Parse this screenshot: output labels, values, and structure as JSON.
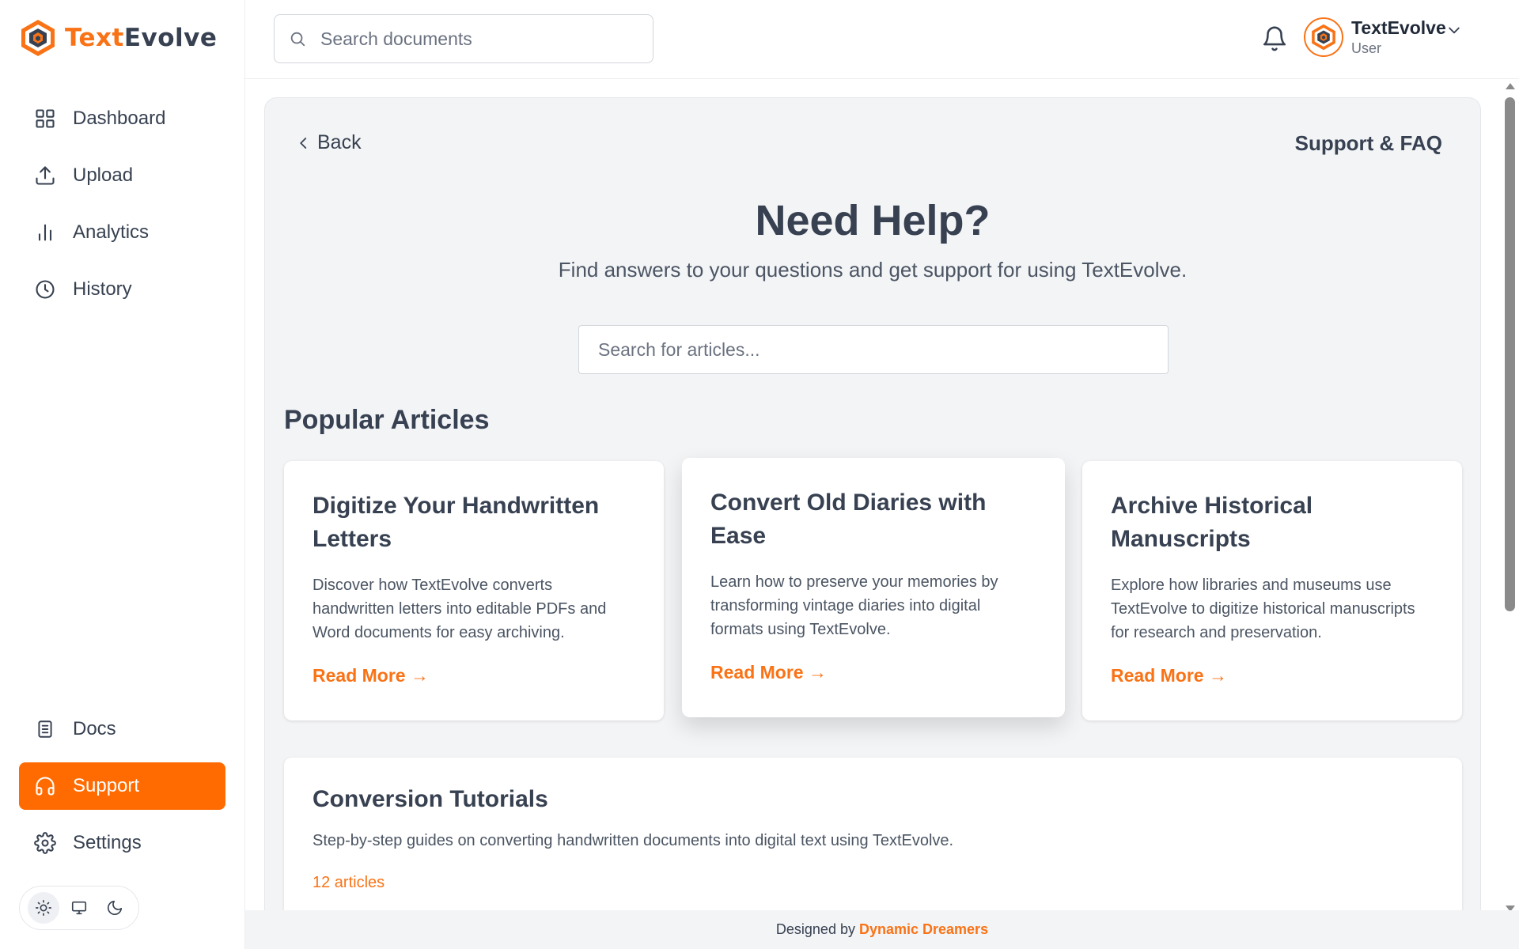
{
  "app": {
    "logo_part1": "Text",
    "logo_part2": "Evolve",
    "accent": "#ff6b00"
  },
  "sidebar": {
    "top_items": [
      {
        "label": "Dashboard",
        "icon": "grid-icon"
      },
      {
        "label": "Upload",
        "icon": "upload-icon"
      },
      {
        "label": "Analytics",
        "icon": "bar-chart-icon"
      },
      {
        "label": "History",
        "icon": "clock-icon"
      }
    ],
    "bottom_items": [
      {
        "label": "Docs",
        "icon": "document-icon"
      },
      {
        "label": "Support",
        "icon": "headphones-icon",
        "active": true
      },
      {
        "label": "Settings",
        "icon": "gear-icon"
      }
    ],
    "theme_options": [
      "light",
      "system",
      "dark"
    ],
    "theme_selected": "light"
  },
  "header": {
    "search_placeholder": "Search documents",
    "user_name": "TextEvolve",
    "user_role": "User"
  },
  "page": {
    "back_label": "Back",
    "section_label": "Support & FAQ",
    "title": "Need Help?",
    "subtitle": "Find answers to your questions and get support for using TextEvolve.",
    "article_search_placeholder": "Search for articles...",
    "popular_title": "Popular Articles",
    "articles": [
      {
        "title": "Digitize Your Handwritten Letters",
        "description": "Discover how TextEvolve converts handwritten letters into editable PDFs and Word documents for easy archiving.",
        "link": "Read More →"
      },
      {
        "title": "Convert Old Diaries with Ease",
        "description": "Learn how to preserve your memories by transforming vintage diaries into digital formats using TextEvolve.",
        "link": "Read More →"
      },
      {
        "title": "Archive Historical Manuscripts",
        "description": "Explore how libraries and museums use TextEvolve to digitize historical manuscripts for research and preservation.",
        "link": "Read More →"
      }
    ],
    "tutorials": {
      "title": "Conversion Tutorials",
      "description": "Step-by-step guides on converting handwritten documents into digital text using TextEvolve.",
      "count": "12 articles"
    }
  },
  "footer": {
    "prefix": "Designed by",
    "brand": "Dynamic Dreamers"
  }
}
